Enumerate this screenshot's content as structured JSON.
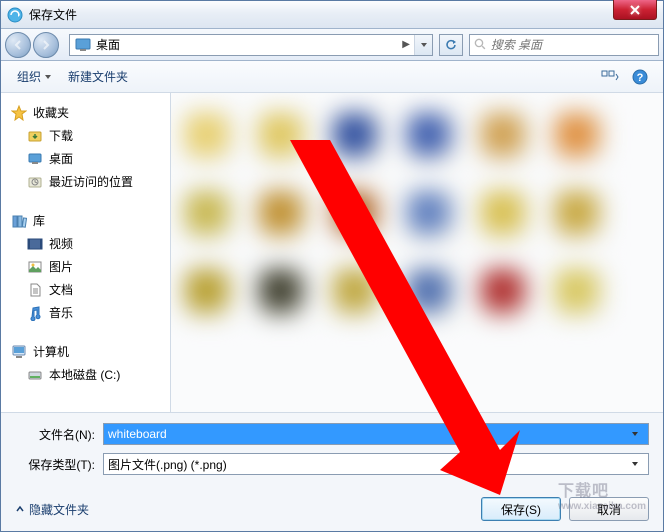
{
  "window": {
    "title": "保存文件"
  },
  "nav": {
    "location": "桌面"
  },
  "search": {
    "placeholder": "搜索 桌面"
  },
  "toolbar": {
    "organize": "组织",
    "new_folder": "新建文件夹"
  },
  "sidebar": {
    "favorites": {
      "label": "收藏夹",
      "items": {
        "downloads": "下载",
        "desktop": "桌面",
        "recent": "最近访问的位置"
      }
    },
    "libraries": {
      "label": "库",
      "items": {
        "videos": "视频",
        "pictures": "图片",
        "documents": "文档",
        "music": "音乐"
      }
    },
    "computer": {
      "label": "计算机",
      "items": {
        "drive_c": "本地磁盘 (C:)"
      }
    }
  },
  "fields": {
    "filename_label": "文件名(N):",
    "filename_value": "whiteboard",
    "filetype_label": "保存类型(T):",
    "filetype_value": "图片文件(.png) (*.png)"
  },
  "buttons": {
    "hide_folders": "隐藏文件夹",
    "save": "保存(S)",
    "cancel": "取消"
  },
  "watermark": {
    "main": "下载吧",
    "sub": "www.xiazaiba.com"
  },
  "thumb_colors": [
    "#e8d070",
    "#e0c860",
    "#3050a0",
    "#4060b0",
    "#d0a050",
    "#e09040",
    "#c8b850",
    "#c09030",
    "#b06020",
    "#6080c0",
    "#d8c050",
    "#c8a840",
    "#b8a030",
    "#404030",
    "#c0a840",
    "#5070b0",
    "#b03030",
    "#d8c860"
  ]
}
